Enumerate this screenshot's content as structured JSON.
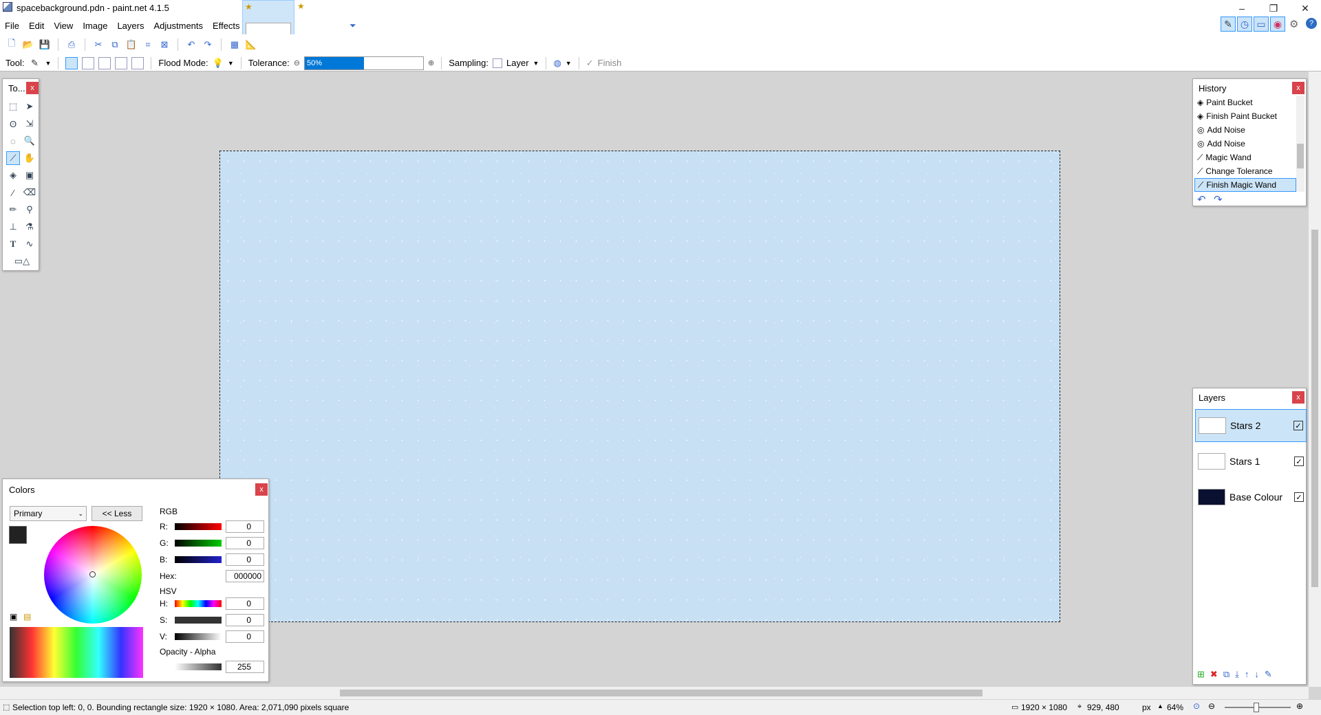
{
  "window": {
    "title": "spacebackground.pdn - paint.net 4.1.5",
    "minimize": "–",
    "restore": "❐",
    "close": "✕"
  },
  "menu": [
    "File",
    "Edit",
    "View",
    "Image",
    "Layers",
    "Adjustments",
    "Effects"
  ],
  "options": {
    "tool_label": "Tool:",
    "flood_mode_label": "Flood Mode:",
    "tolerance_label": "Tolerance:",
    "tolerance_value": "50%",
    "tolerance_fraction": 0.5,
    "sampling_label": "Sampling:",
    "sampling_value": "Layer",
    "finish_label": "Finish"
  },
  "tools_panel": {
    "title": "To...",
    "close": "x"
  },
  "history_panel": {
    "title": "History",
    "close": "x",
    "items": [
      "Paint Bucket",
      "Finish Paint Bucket",
      "Add Noise",
      "Add Noise",
      "Magic Wand",
      "Change Tolerance",
      "Finish Magic Wand"
    ],
    "active_index": 6
  },
  "layers_panel": {
    "title": "Layers",
    "close": "x",
    "layers": [
      {
        "name": "Stars 2",
        "visible": true,
        "thumb_color": "#ffffff"
      },
      {
        "name": "Stars 1",
        "visible": true,
        "thumb_color": "#ffffff"
      },
      {
        "name": "Base Colour",
        "visible": true,
        "thumb_color": "#0a1030"
      }
    ],
    "active_index": 0
  },
  "colors_panel": {
    "title": "Colors",
    "close": "x",
    "mode": "Primary",
    "less_button": "<< Less",
    "rgb_label": "RGB",
    "hsv_label": "HSV",
    "r_label": "R:",
    "g_label": "G:",
    "b_label": "B:",
    "hex_label": "Hex:",
    "h_label": "H:",
    "s_label": "S:",
    "v_label": "V:",
    "r": "0",
    "g": "0",
    "b": "0",
    "hex": "000000",
    "h": "0",
    "s": "0",
    "v": "0",
    "opacity_label": "Opacity - Alpha",
    "alpha": "255"
  },
  "status": {
    "message": "Selection top left: 0, 0. Bounding rectangle size: 1920 × 1080. Area: 2,071,090 pixels square",
    "image_size": "1920 × 1080",
    "cursor": "929, 480",
    "units": "px",
    "zoom": "64%"
  },
  "colors": {
    "accent": "#3399ff",
    "canvas": "#c8e0f4",
    "close": "#d9434b"
  }
}
